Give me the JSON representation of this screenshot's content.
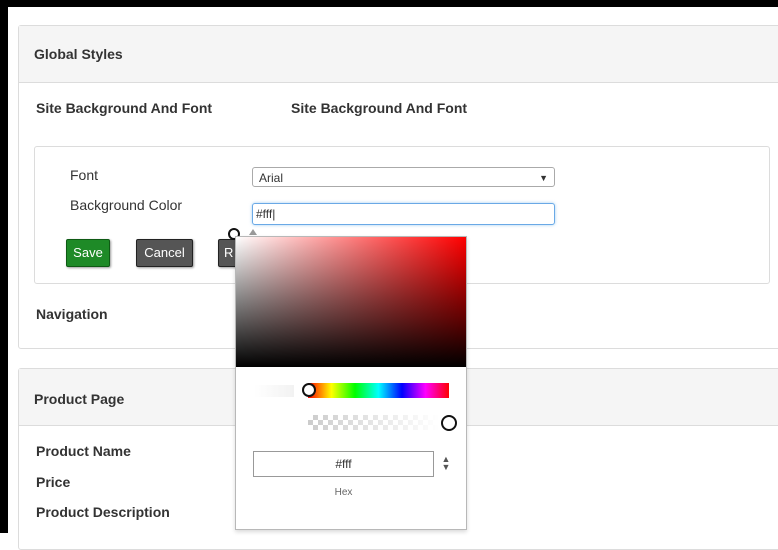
{
  "global_styles": {
    "title": "Global Styles",
    "section_label": "Site Background And Font",
    "section_value": "Site Background And Font",
    "font_label": "Font",
    "font_value": "Arial",
    "background_label": "Background Color",
    "background_value": "#fff|",
    "buttons": {
      "save": "Save",
      "cancel": "Cancel",
      "reset": "R"
    },
    "navigation_label": "Navigation"
  },
  "product_page": {
    "title": "Product Page",
    "items": [
      "Product Name",
      "Price",
      "Product Description"
    ]
  },
  "color_picker": {
    "hex_value": "#fff",
    "hex_label": "Hex",
    "hue_color": "#ff0000"
  },
  "colors": {
    "save_button": "#1e8a27",
    "dark_button": "#555555",
    "focus_border": "#6aa9e6"
  },
  "icons": {
    "select_arrow": "caret-down-icon",
    "mode_toggle": "up-down-arrows-icon"
  }
}
